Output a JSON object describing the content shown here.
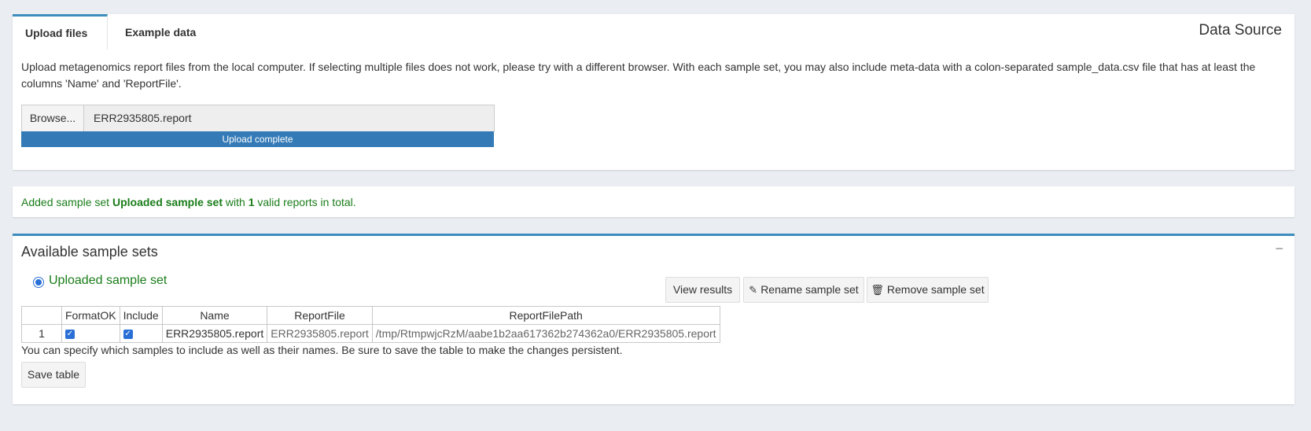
{
  "tabs": [
    {
      "label": "Upload files",
      "active": true
    },
    {
      "label": "Example data",
      "active": false
    }
  ],
  "data_source_title": "Data Source",
  "upload_description": "Upload metagenomics report files from the local computer. If selecting multiple files does not work, please try with a different browser. With each sample set, you may also include meta-data with a colon-separated sample_data.csv file that has at least the columns 'Name' and 'ReportFile'.",
  "file_input": {
    "browse_label": "Browse...",
    "file_name": "ERR2935805.report",
    "progress_label": "Upload complete",
    "progress": 1.0
  },
  "message": {
    "prefix": "Added sample set ",
    "set_name": "Uploaded sample set",
    "middle": " with ",
    "count": "1",
    "suffix": " valid reports in total."
  },
  "available": {
    "title": "Available sample sets",
    "collapse_symbol": "−",
    "radio_label": "Uploaded sample set",
    "buttons": {
      "view": "View results",
      "rename": "Rename sample set",
      "remove": "Remove sample set"
    },
    "table": {
      "headers": [
        "",
        "FormatOK",
        "Include",
        "Name",
        "ReportFile",
        "ReportFilePath"
      ],
      "rows": [
        {
          "index": "1",
          "format_ok": true,
          "include": true,
          "name": "ERR2935805.report",
          "report_file": "ERR2935805.report",
          "report_file_path": "/tmp/RtmpwjcRzM/aabe1b2aa617362b274362a0/ERR2935805.report"
        }
      ]
    },
    "note": "You can specify which samples to include as well as their names. Be sure to save the table to make the changes persistent.",
    "save_label": "Save table"
  },
  "colors": {
    "accent": "#3c8dbc",
    "progress": "#337ab7",
    "success_text": "#1a7d1a",
    "checkbox": "#2a6fd6"
  }
}
